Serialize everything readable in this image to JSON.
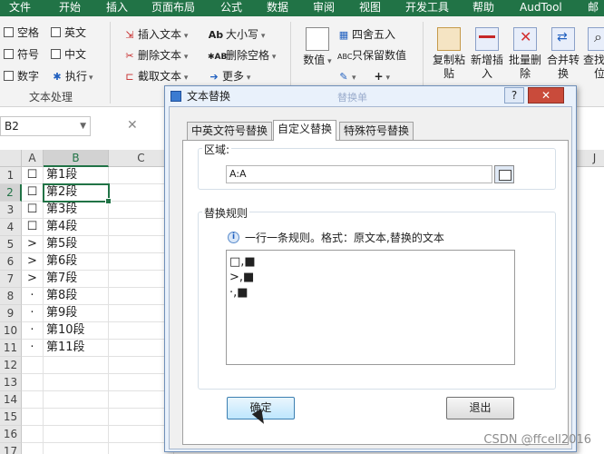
{
  "ribbon_tabs": [
    "文件",
    "开始",
    "插入",
    "页面布局",
    "公式",
    "数据",
    "审阅",
    "视图",
    "开发工具",
    "帮助",
    "AudTool",
    "邮件"
  ],
  "ribbon": {
    "text_group": {
      "kongge": "空格",
      "yingwen": "英文",
      "fuhao": "符号",
      "zhongwen": "中文",
      "shuzi": "数字",
      "zhixing": "执行",
      "label": "文本处理"
    },
    "edit_group": {
      "insert_text": "插入文本",
      "delete_text": "删除文本",
      "extract_text": "截取文本",
      "case": "大小写",
      "remove_space": "删除空格",
      "more": "更多"
    },
    "number_group": {
      "shuzhi": "数值",
      "round": "四舍五入",
      "keep_number": "只保留数值"
    },
    "big_buttons": [
      "复制粘贴",
      "新增插入",
      "批量删除",
      "合并转换",
      "查找定位"
    ]
  },
  "formula_bar": {
    "name_box": "B2",
    "cancel": "✕"
  },
  "sheet": {
    "columns": [
      "A",
      "B",
      "C"
    ],
    "right_column": "J",
    "rows": [
      {
        "n": "1",
        "a": "☐",
        "b": "第1段"
      },
      {
        "n": "2",
        "a": "☐",
        "b": "第2段"
      },
      {
        "n": "3",
        "a": "☐",
        "b": "第3段"
      },
      {
        "n": "4",
        "a": "☐",
        "b": "第4段"
      },
      {
        "n": "5",
        "a": ">",
        "b": "第5段"
      },
      {
        "n": "6",
        "a": ">",
        "b": "第6段"
      },
      {
        "n": "7",
        "a": ">",
        "b": "第7段"
      },
      {
        "n": "8",
        "a": "·",
        "b": "第8段"
      },
      {
        "n": "9",
        "a": "·",
        "b": "第9段"
      },
      {
        "n": "10",
        "a": "·",
        "b": "第10段"
      },
      {
        "n": "11",
        "a": "·",
        "b": "第11段"
      },
      {
        "n": "12",
        "a": "",
        "b": ""
      },
      {
        "n": "13",
        "a": "",
        "b": ""
      },
      {
        "n": "14",
        "a": "",
        "b": ""
      },
      {
        "n": "15",
        "a": "",
        "b": ""
      },
      {
        "n": "16",
        "a": "",
        "b": ""
      },
      {
        "n": "17",
        "a": "",
        "b": ""
      }
    ]
  },
  "dialog": {
    "title": "文本替换",
    "ghost_title": "替换单",
    "help": "?",
    "close": "✕",
    "tabs": [
      "中英文符号替换",
      "自定义替换",
      "特殊符号替换"
    ],
    "area_label": "区域:",
    "area_value": "A:A",
    "rules_label": "替换规则",
    "hint": "一行一条规则。格式：原文本,替换的文本",
    "rules": [
      "□,■",
      ">,■",
      "·,■"
    ],
    "ok": "确定",
    "exit": "退出"
  },
  "watermark": "CSDN @ffcell2016",
  "colors": {
    "excel_green": "#217346",
    "dialog_border": "#6f8fb8"
  }
}
